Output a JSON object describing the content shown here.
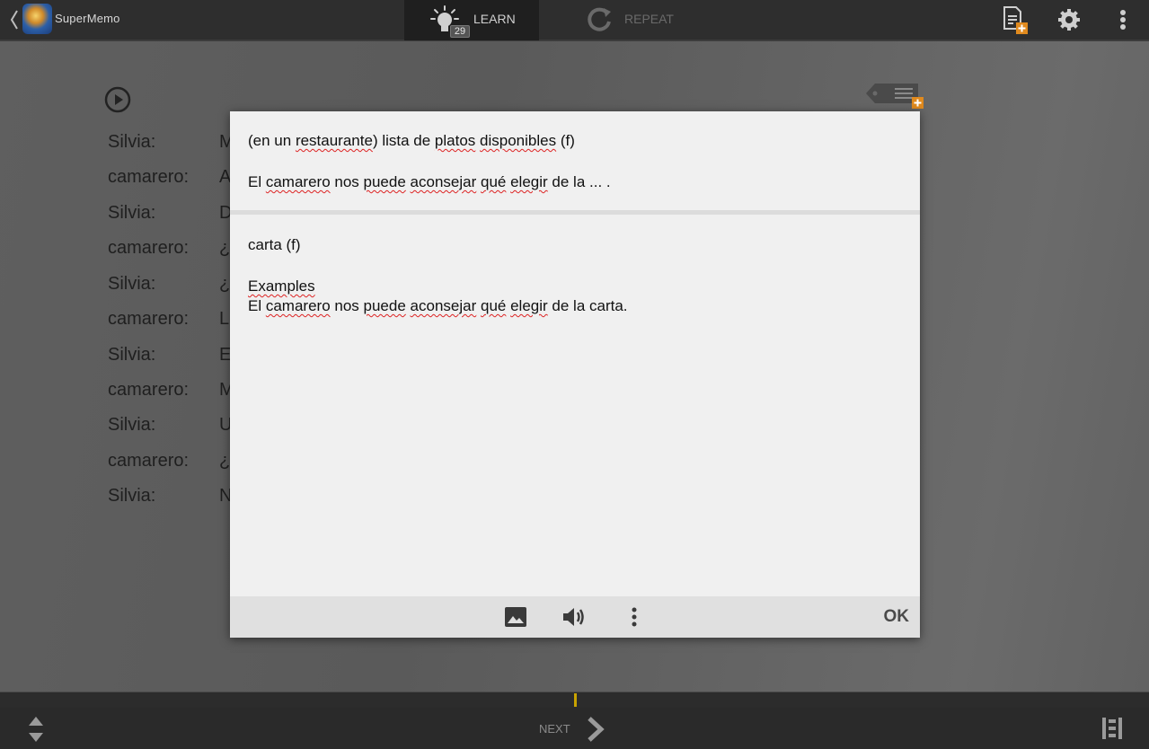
{
  "app": {
    "name": "SuperMemo"
  },
  "tabs": {
    "learn": {
      "label": "LEARN",
      "count": "29"
    },
    "repeat": {
      "label": "REPEAT"
    }
  },
  "dialog": [
    {
      "speaker": "Silvia:",
      "text": "M"
    },
    {
      "speaker": "camarero:",
      "text": "A"
    },
    {
      "speaker": "Silvia:",
      "text": "D"
    },
    {
      "speaker": "camarero:",
      "text": "¿"
    },
    {
      "speaker": "Silvia:",
      "text": "¿"
    },
    {
      "speaker": "camarero:",
      "text": "L"
    },
    {
      "speaker": "Silvia:",
      "text": "E"
    },
    {
      "speaker": "camarero:",
      "text": "M"
    },
    {
      "speaker": "Silvia:",
      "text": "U"
    },
    {
      "speaker": "camarero:",
      "text": "¿"
    },
    {
      "speaker": "Silvia:",
      "text": "N"
    }
  ],
  "modal": {
    "question": {
      "line1_pre": "(en un ",
      "line1_w1": "restaurante",
      "line1_mid": ") lista de ",
      "line1_w2": "platos",
      "line1_sp": " ",
      "line1_w3": "disponibles",
      "line1_post": " (f)",
      "line2_pre": "El ",
      "line2_w1": "camarero",
      "line2_sp1": " nos ",
      "line2_w2": "puede",
      "line2_sp2": " ",
      "line2_w3": "aconsejar",
      "line2_sp3": " ",
      "line2_w4": "qué",
      "line2_sp4": " ",
      "line2_w5": "elegir",
      "line2_post": " de la ... ."
    },
    "answer": {
      "word": "carta (f)",
      "examples_label": "Examples",
      "ex_pre": "El ",
      "ex_w1": "camarero",
      "ex_sp1": " nos ",
      "ex_w2": "puede",
      "ex_sp2": " ",
      "ex_w3": "aconsejar",
      "ex_sp3": " ",
      "ex_w4": "qué",
      "ex_sp4": " ",
      "ex_w5": "elegir",
      "ex_post": " de la carta."
    },
    "ok_label": "OK"
  },
  "bottom": {
    "next_label": "NEXT"
  },
  "icons": {
    "back": "chevron-left-icon",
    "learn": "lightbulb-icon",
    "repeat": "repeat-icon",
    "add_page": "add-page-icon",
    "settings": "gear-icon",
    "menu": "more-vertical-icon",
    "play": "play-icon",
    "tag": "tag-add-icon",
    "image": "image-icon",
    "sound": "speaker-icon",
    "modal_menu": "more-vertical-icon",
    "next": "chevron-right-icon",
    "updown": "up-down-icon",
    "list": "list-icon"
  },
  "colors": {
    "accent": "#c9a300",
    "badge_add": "#e08a1e"
  }
}
